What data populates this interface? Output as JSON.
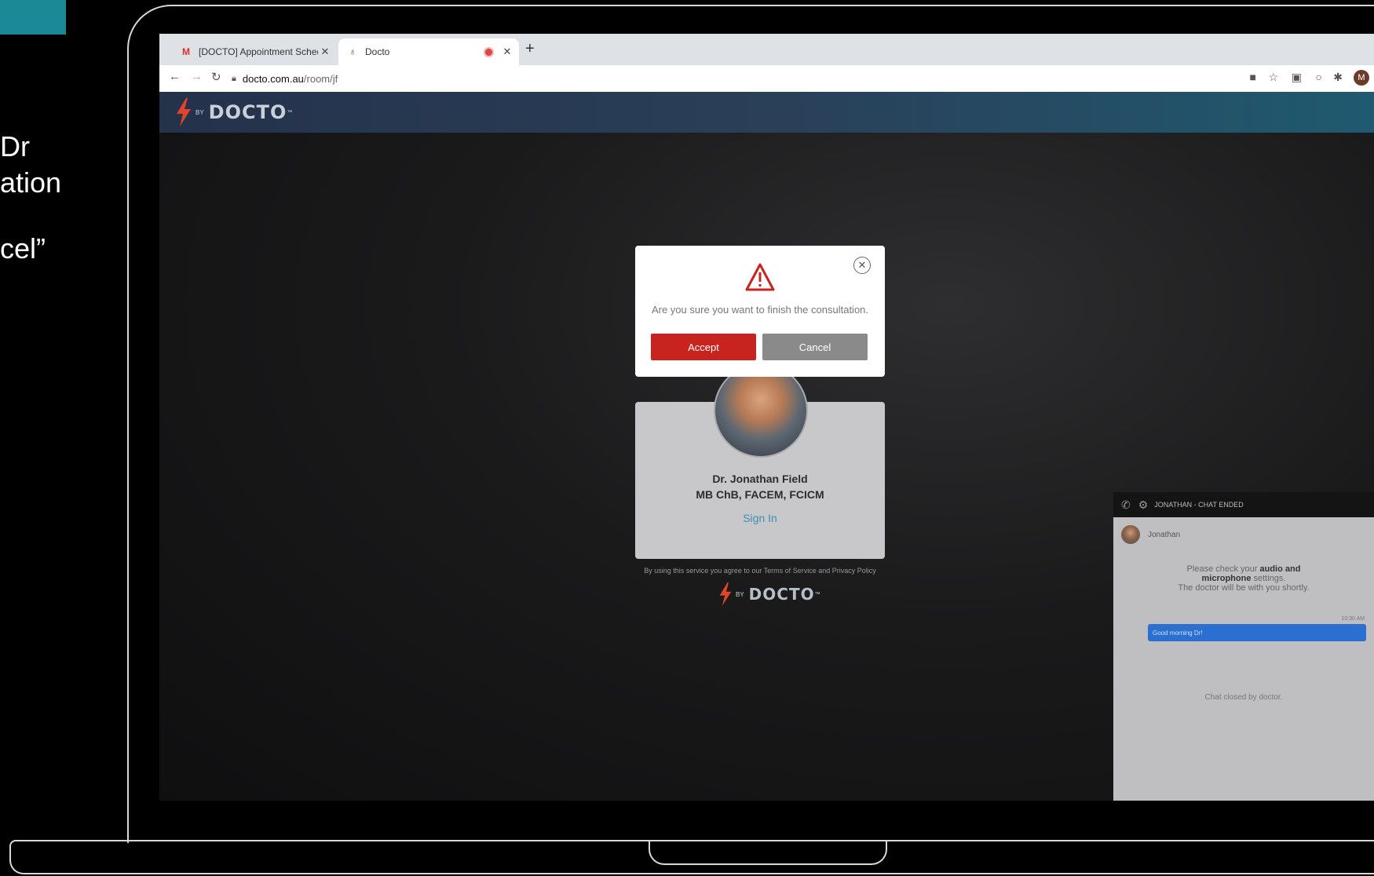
{
  "slide_text": {
    "line1": "Dr",
    "line2": "ation",
    "line3": "cel”"
  },
  "browser": {
    "tabs": [
      {
        "favicon": "gmail-icon",
        "title": "[DOCTO] Appointment Sched…"
      },
      {
        "favicon": "docto-favicon",
        "title": "Docto"
      }
    ],
    "url_domain": "docto.com.au",
    "url_path": "/room/jf",
    "profile_initial": "M"
  },
  "header": {
    "logo_text": "DOCTO",
    "logo_by": "BY",
    "logo_tm": "™"
  },
  "modal": {
    "message": "Are you sure you want to finish the consultation.",
    "accept_label": "Accept",
    "cancel_label": "Cancel"
  },
  "doctor": {
    "name": "Dr. Jonathan Field",
    "credentials": "MB ChB, FACEM, FCICM",
    "sign_in_label": "Sign In"
  },
  "terms_text": "By using this service you agree to our Terms of Service and Privacy Policy",
  "footer_logo": "DOCTO",
  "chat": {
    "header_title": "JONATHAN - CHAT ENDED",
    "user_name": "Jonathan",
    "info_prefix": "Please check your ",
    "info_bold1": "audio and",
    "info_bold2": "microphone",
    "info_suffix": " settings.",
    "info_line3": "The doctor will be with you shortly.",
    "message_time": "10:30 AM",
    "message_text": "Good morning Dr!",
    "closed_text": "Chat closed by doctor."
  },
  "colors": {
    "accent_teal": "#1b8a96",
    "accept_red": "#c8231f",
    "cancel_gray": "#8a8a8a",
    "sign_in_blue": "#3d8fb6",
    "chat_bubble_blue": "#2b6fd1"
  }
}
